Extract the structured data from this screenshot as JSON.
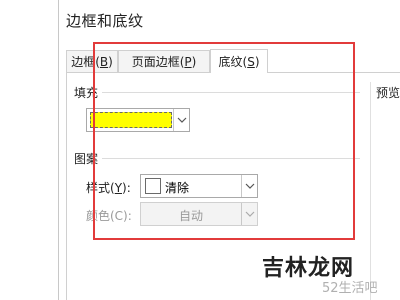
{
  "dialog": {
    "title": "边框和底纹",
    "tabs": [
      {
        "label": "边框(",
        "mnemonic": "B",
        "close": ")"
      },
      {
        "label": "页面边框(",
        "mnemonic": "P",
        "close": ")"
      },
      {
        "label": "底纹(",
        "mnemonic": "S",
        "close": ")"
      }
    ],
    "active_tab": "底纹(S)"
  },
  "fill": {
    "section_label": "填充",
    "color": "#ffff00"
  },
  "pattern": {
    "section_label": "图案",
    "style_label": "样式(",
    "style_mnemonic": "Y",
    "style_label_close": "):",
    "style_value": "清除",
    "color_label": "颜色(C):",
    "color_value": "自动"
  },
  "preview": {
    "label": "预览"
  },
  "watermark": {
    "brand": "吉林龙网",
    "site": "52生活吧"
  },
  "colors": {
    "highlight": "#e23b3b",
    "fill_swatch": "#ffff00"
  }
}
